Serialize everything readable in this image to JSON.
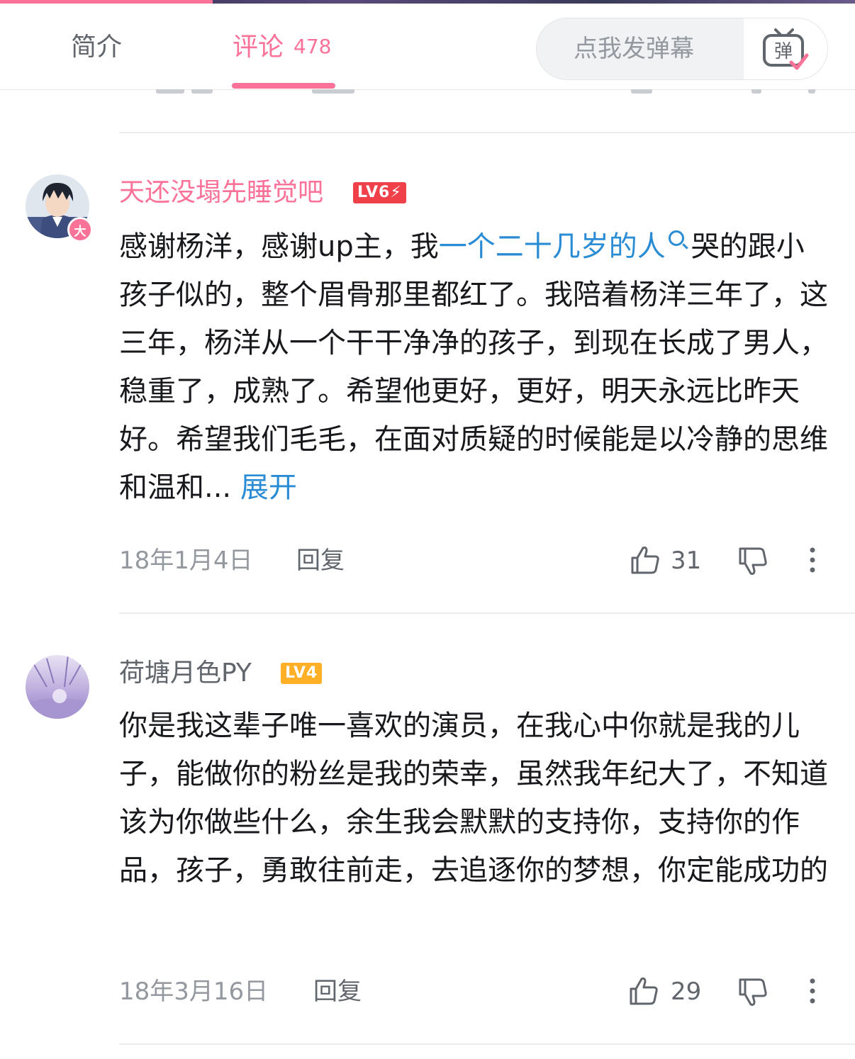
{
  "tabs": {
    "intro_label": "简介",
    "comments_label": "评论",
    "comments_count": "478"
  },
  "danmaku": {
    "placeholder": "点我发弹幕",
    "button_glyph": "弹"
  },
  "comments": [
    {
      "username": "天还没塌先睡觉吧",
      "username_color": "#fb7299",
      "level": "LV6",
      "avatar_badge": "大",
      "text_before_link": "感谢杨洋，感谢up主，我",
      "link_text": "一个二十几岁的人",
      "text_after_link": "哭的跟小孩子似的，整个眉骨那里都红了。我陪着杨洋三年了，这三年，杨洋从一个干干净净的孩子，到现在长成了男人，稳重了，成熟了。希望他更好，更好，明天永远比昨天好。希望我们毛毛，在面对质疑的时候能是以冷静的思维和温和...",
      "expand_label": "展开",
      "date": "18年1月4日",
      "reply_label": "回复",
      "like_count": "31"
    },
    {
      "username": "荷塘月色PY",
      "username_color": "#61666d",
      "level": "LV4",
      "text": "你是我这辈子唯一喜欢的演员，在我心中你就是我的儿子，能做你的粉丝是我的荣幸，虽然我年纪大了，不知道该为你做些什么，余生我会默默的支持你，支持你的作品，孩子，勇敢往前走，去追逐你的梦想，你定能成功的",
      "date": "18年3月16日",
      "reply_label": "回复",
      "like_count": "29"
    }
  ],
  "colors": {
    "accent": "#fb7299",
    "link": "#2a8cd5",
    "level6": "#f0404a",
    "level4": "#ffb027"
  },
  "icons": [
    "like-icon",
    "dislike-icon",
    "more-icon",
    "search-icon",
    "danmaku-icon"
  ]
}
